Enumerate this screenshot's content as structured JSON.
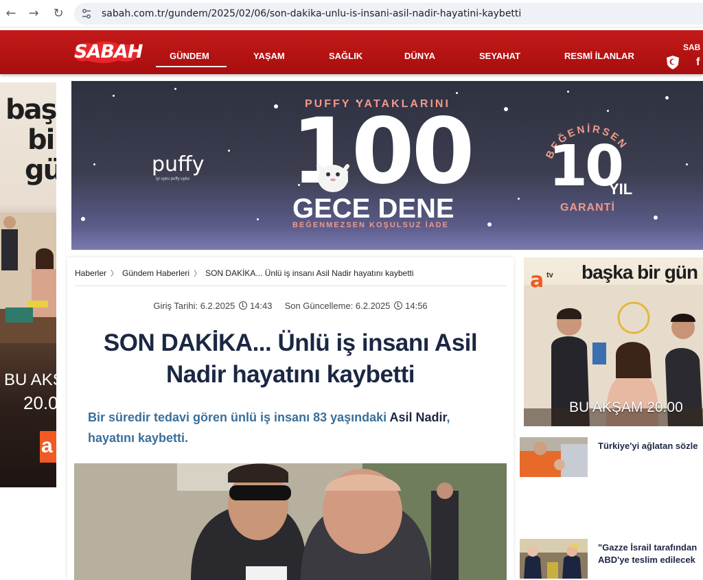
{
  "browser": {
    "back_icon": "←",
    "forward_icon": "→",
    "reload_icon": "↻",
    "url": "sabah.com.tr/gundem/2025/02/06/son-dakika-unlu-is-insani-asil-nadir-hayatini-kaybetti"
  },
  "header": {
    "logo": "SABAH",
    "nav": [
      {
        "label": "GÜNDEM",
        "active": true
      },
      {
        "label": "YAŞAM"
      },
      {
        "label": "SAĞLIK"
      },
      {
        "label": "DÜNYA"
      },
      {
        "label": "SEYAHAT"
      },
      {
        "label": "RESMİ İLANLAR"
      }
    ],
    "right_text": "SAB",
    "right_social": "f",
    "brand_color": "#c41a1a"
  },
  "left_ad": {
    "title_lines": [
      "baş",
      "bi",
      "gü"
    ],
    "tagline": "BU AKŞ",
    "time": "20.0",
    "channel": "a"
  },
  "banner_ad": {
    "brand": "puffy",
    "brand_sub": "iyi uyku puffy uyku",
    "headline_top": "PUFFY YATAKLARINI",
    "big_number": "100",
    "headline_main": "GECE DENE",
    "headline_bottom": "BEĞENMEZSEN KOŞULSUZ İADE",
    "badge_arc": "BEĞENİRSEN",
    "badge_number": "10",
    "badge_unit": "YIL",
    "badge_bottom": "GARANTİ"
  },
  "article": {
    "breadcrumb": [
      "Haberler",
      "Gündem Haberleri",
      "SON DAKİKA... Ünlü iş insanı Asil Nadir hayatını kaybetti"
    ],
    "published_label": "Giriş Tarihi: 6.2.2025",
    "published_time": "14:43",
    "updated_label": "Son Güncelleme: 6.2.2025",
    "updated_time": "14:56",
    "headline": "SON DAKİKA... Ünlü iş insanı Asil Nadir hayatını kaybetti",
    "spot_part1": "Bir süredir tedavi gören ünlü iş insanı 83 yaşındaki ",
    "spot_person": "Asil Nadir",
    "spot_part2": ", hayatını kaybetti."
  },
  "right_ad": {
    "channel": "a",
    "channel_suffix": "tv",
    "title": "başka bir gün",
    "tagline": "BU AKŞAM 20.00"
  },
  "news_list": [
    {
      "title": "Türkiye'yi ağlatan sözle"
    },
    {
      "title": "\"Gazze İsrail tarafından\nABD'ye teslim edilecek"
    }
  ]
}
